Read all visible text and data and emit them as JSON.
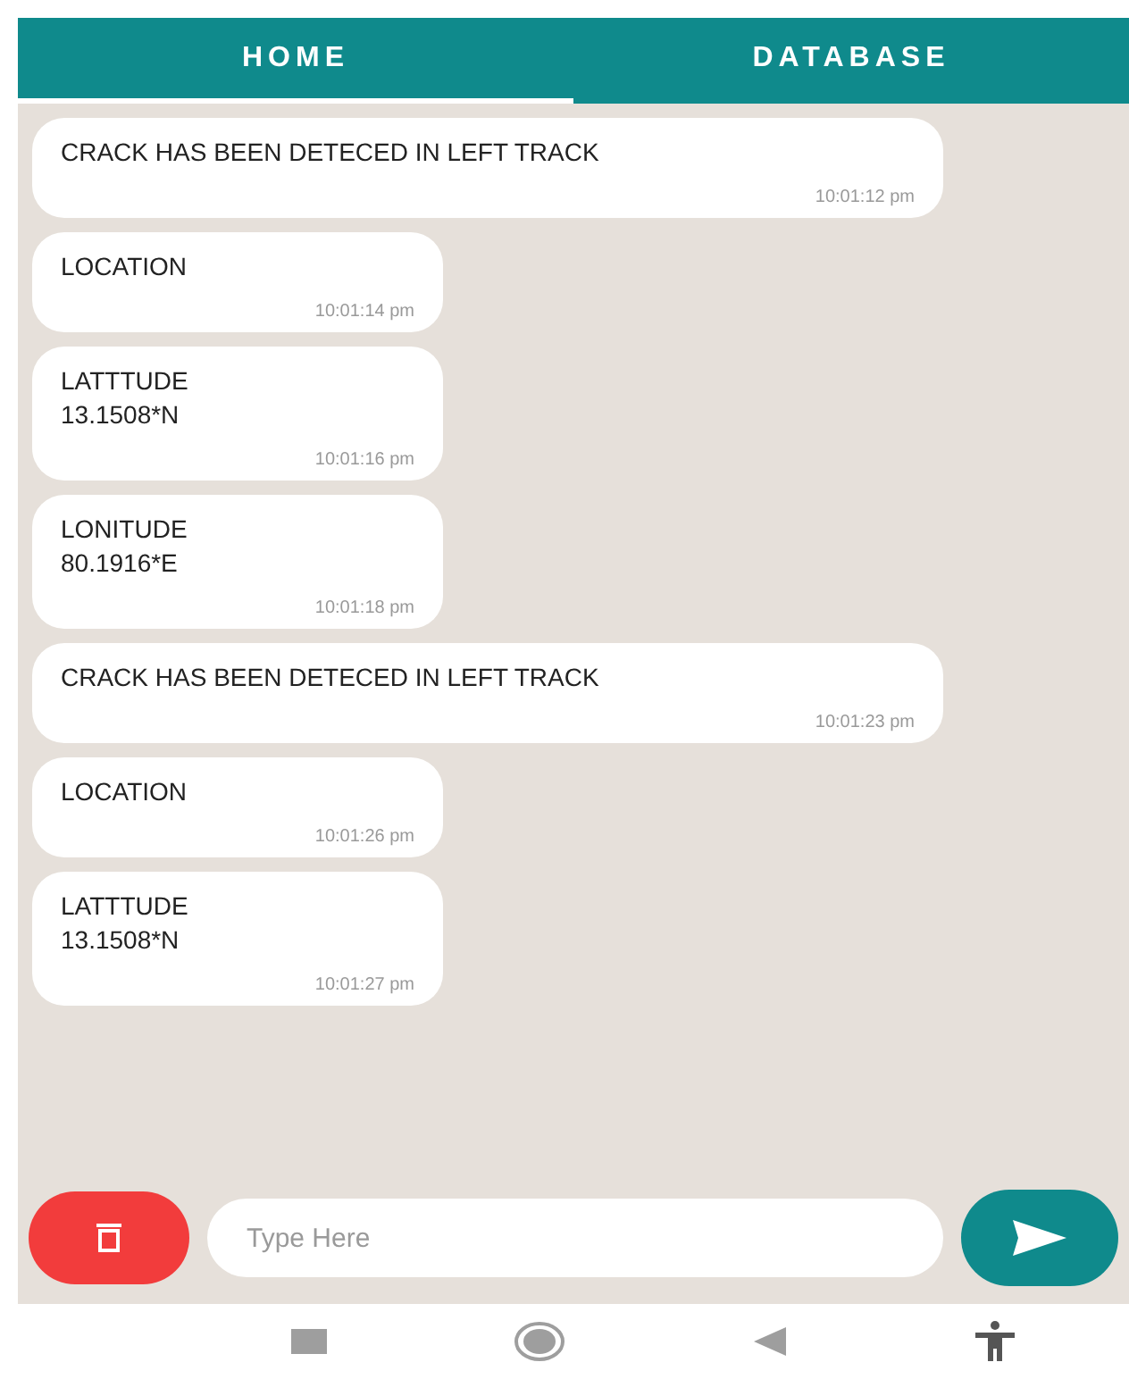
{
  "tabs": [
    {
      "label": "HOME",
      "selected": true
    },
    {
      "label": "DATABASE",
      "selected": false
    }
  ],
  "messages": [
    {
      "lines": [
        "CRACK HAS BEEN DETECED IN LEFT TRACK"
      ],
      "time": "10:01:12 pm",
      "wide": true
    },
    {
      "lines": [
        "LOCATION"
      ],
      "time": "10:01:14 pm",
      "wide": false
    },
    {
      "lines": [
        "LATTTUDE",
        "13.1508*N"
      ],
      "time": "10:01:16 pm",
      "wide": false
    },
    {
      "lines": [
        "LONITUDE",
        "80.1916*E"
      ],
      "time": "10:01:18 pm",
      "wide": false
    },
    {
      "lines": [
        "CRACK HAS BEEN DETECED IN LEFT TRACK"
      ],
      "time": "10:01:23 pm",
      "wide": true
    },
    {
      "lines": [
        "LOCATION"
      ],
      "time": "10:01:26 pm",
      "wide": false
    },
    {
      "lines": [
        "LATTTUDE",
        "13.1508*N"
      ],
      "time": "10:01:27 pm",
      "wide": false
    }
  ],
  "input": {
    "placeholder": "Type Here"
  }
}
